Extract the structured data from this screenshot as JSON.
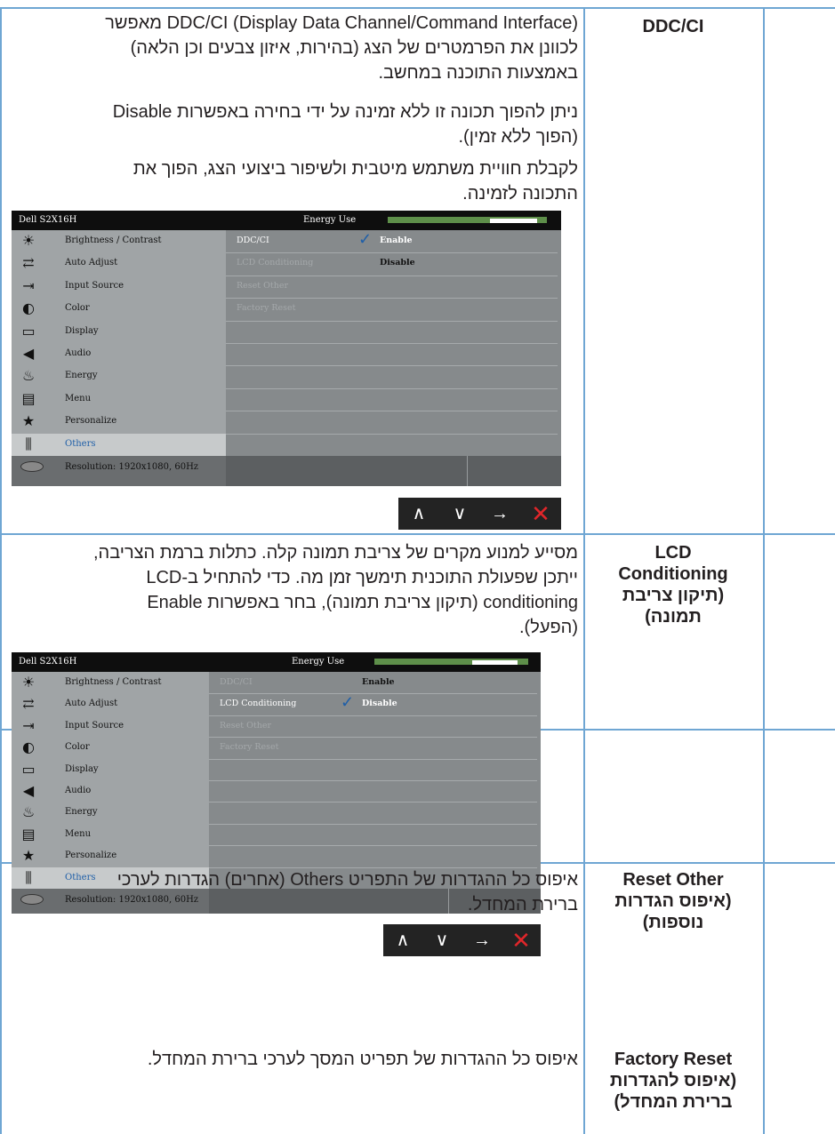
{
  "rows": [
    {
      "label": [
        "DDC/CI"
      ],
      "paragraphs": [
        [
          "(Display Data Channel/Command Interface) DDC/CI מאפשר",
          "לכוונן את הפרמטרים של הצג (בהירות, איזון צבעים וכן הלאה)",
          "באמצעות התוכנה במחשב."
        ],
        [
          "ניתן להפוך תכונה זו ללא זמינה על ידי בחירה באפשרות Disable",
          "(הפוך ללא זמין)."
        ],
        [
          "לקבלת חוויית משתמש מיטבית ולשיפור ביצועי הצג, הפוך את",
          "התכונה לזמינה."
        ]
      ]
    },
    {
      "label": [
        "LCD",
        "Conditioning",
        "(תיקון צריבת",
        "תמונה)"
      ],
      "paragraphs": [
        [
          "מסייע למנוע מקרים של צריבת תמונה קלה. כתלות ברמת הצריבה,",
          "ייתכן שפעולת התוכנית תימשך זמן מה. כדי להתחיל ב-LCD",
          "conditioning (תיקון צריבת תמונה), בחר באפשרות Enable",
          "(הפעל)."
        ]
      ]
    },
    {
      "label": [
        "Reset Other",
        "(איפוס הגדרות",
        "נוספות)"
      ],
      "paragraphs": [
        [
          "איפוס כל ההגדרות של התפריט Others (אחרים) הגדרות לערכי",
          "ברירת המחדל."
        ]
      ]
    },
    {
      "label": [
        "Factory Reset",
        "(איפוס להגדרות",
        "ברירת המחדל)"
      ],
      "paragraphs": [
        [
          "איפוס כל ההגדרות של תפריט המסך לערכי ברירת המחדל."
        ]
      ]
    }
  ],
  "osd_common": {
    "model": "Dell S2X16H",
    "energy_label": "Energy Use",
    "menu": [
      {
        "icon": "brightness-icon",
        "glyph": "☀",
        "label": "Brightness / Contrast"
      },
      {
        "icon": "auto-adjust-icon",
        "glyph": "⇄",
        "label": "Auto Adjust"
      },
      {
        "icon": "input-source-icon",
        "glyph": "⇥",
        "label": "Input Source"
      },
      {
        "icon": "color-icon",
        "glyph": "◐",
        "label": "Color"
      },
      {
        "icon": "display-icon",
        "glyph": "▭",
        "label": "Display"
      },
      {
        "icon": "audio-icon",
        "glyph": "◀",
        "label": "Audio"
      },
      {
        "icon": "energy-icon",
        "glyph": "♨",
        "label": "Energy"
      },
      {
        "icon": "menu-icon",
        "glyph": "▤",
        "label": "Menu"
      },
      {
        "icon": "personalize-icon",
        "glyph": "★",
        "label": "Personalize"
      },
      {
        "icon": "others-icon",
        "glyph": "⫼",
        "label": "Others"
      }
    ],
    "resolution": "Resolution: 1920x1080, 60Hz",
    "submenu": [
      "DDC/CI",
      "LCD Conditioning",
      "Reset Other",
      "Factory Reset"
    ],
    "nav": [
      {
        "icon": "up-arrow-icon",
        "glyph": "∧"
      },
      {
        "icon": "down-arrow-icon",
        "glyph": "∨"
      },
      {
        "icon": "right-arrow-icon",
        "glyph": "→"
      },
      {
        "icon": "close-icon",
        "glyph": "✕"
      }
    ]
  },
  "osd1": {
    "value_col": [
      "Enable",
      "Disable"
    ],
    "checked": "Enable",
    "active_item": "DDC/CI"
  },
  "osd2": {
    "value_col": [
      "Enable",
      "Disable"
    ],
    "checked": "Disable",
    "active_item": "LCD Conditioning"
  },
  "colors": {
    "rule": "#6fa6d3",
    "highlight": "#1f5fa8",
    "energy": "#5e8f4a",
    "close": "#e0262a"
  }
}
